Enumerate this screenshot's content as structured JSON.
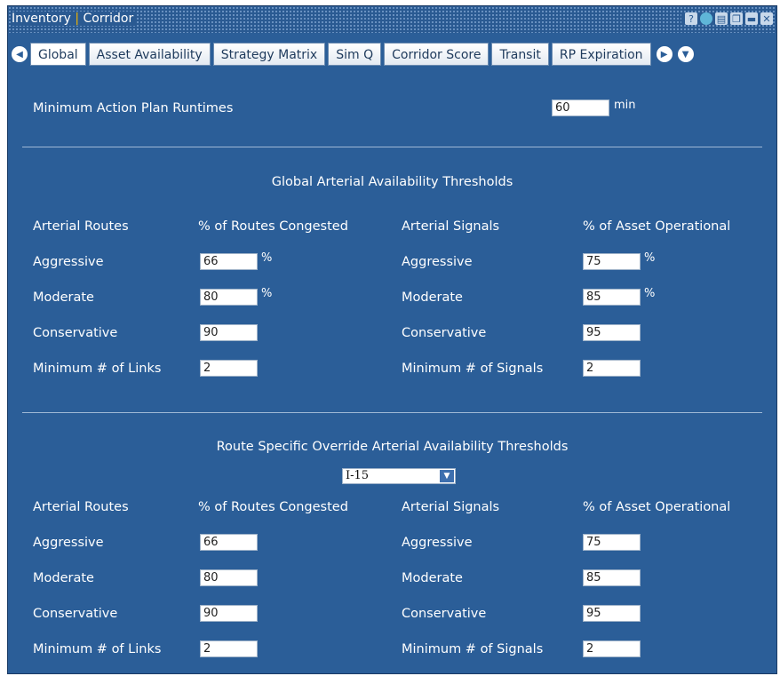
{
  "window": {
    "title_part1": "Inventory",
    "title_sep": "|",
    "title_part2": "Corridor",
    "controls": [
      "help-icon",
      "globe-icon",
      "print-icon",
      "restore-icon",
      "minimize-icon",
      "close-icon"
    ]
  },
  "tabs": [
    {
      "label": "Global",
      "active": true
    },
    {
      "label": "Asset Availability"
    },
    {
      "label": "Strategy Matrix"
    },
    {
      "label": "Sim Q"
    },
    {
      "label": "Corridor Score"
    },
    {
      "label": "Transit"
    },
    {
      "label": "RP Expiration"
    }
  ],
  "runtime": {
    "label": "Minimum Action Plan Runtimes",
    "value": "60",
    "unit": "min"
  },
  "global_section": {
    "title": "Global Arterial Availability Thresholds",
    "routes_header": "Arterial Routes",
    "routes_value_header": "% of Routes Congested",
    "signals_header": "Arterial Signals",
    "signals_value_header": "% of Asset Operational",
    "routes": [
      {
        "label": "Aggressive",
        "value": "66",
        "unit": "%"
      },
      {
        "label": "Moderate",
        "value": "80",
        "unit": "%"
      },
      {
        "label": "Conservative",
        "value": "90",
        "unit": ""
      },
      {
        "label": "Minimum # of Links",
        "value": "2",
        "unit": ""
      }
    ],
    "signals": [
      {
        "label": "Aggressive",
        "value": "75",
        "unit": "%"
      },
      {
        "label": "Moderate",
        "value": "85",
        "unit": "%"
      },
      {
        "label": "Conservative",
        "value": "95",
        "unit": ""
      },
      {
        "label": "Minimum # of Signals",
        "value": "2",
        "unit": ""
      }
    ]
  },
  "route_section": {
    "title": "Route Specific Override Arterial Availability Thresholds",
    "selected_route": "I-15",
    "routes_header": "Arterial Routes",
    "routes_value_header": "% of Routes Congested",
    "signals_header": "Arterial Signals",
    "signals_value_header": "% of Asset Operational",
    "routes": [
      {
        "label": "Aggressive",
        "value": "66"
      },
      {
        "label": "Moderate",
        "value": "80"
      },
      {
        "label": "Conservative",
        "value": "90"
      },
      {
        "label": "Minimum # of Links",
        "value": "2"
      }
    ],
    "signals": [
      {
        "label": "Aggressive",
        "value": "75"
      },
      {
        "label": "Moderate",
        "value": "85"
      },
      {
        "label": "Conservative",
        "value": "95"
      },
      {
        "label": "Minimum # of Signals",
        "value": "2"
      }
    ]
  }
}
